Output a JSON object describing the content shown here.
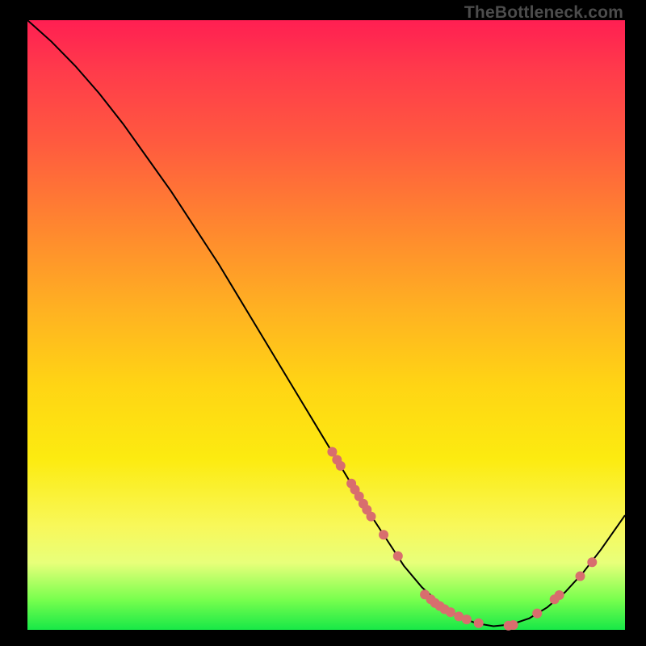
{
  "watermark": "TheBottleneck.com",
  "chart_data": {
    "type": "line",
    "title": "",
    "xlabel": "",
    "ylabel": "",
    "xlim": [
      0,
      100
    ],
    "ylim": [
      0,
      100
    ],
    "curve": {
      "x": [
        0,
        4,
        8,
        12,
        16,
        20,
        24,
        28,
        32,
        36,
        40,
        44,
        48,
        52,
        56,
        60,
        63,
        66,
        69,
        72,
        75,
        78,
        81,
        84,
        87,
        90,
        93,
        96,
        100
      ],
      "y": [
        100,
        96.5,
        92.5,
        88,
        83,
        77.5,
        72,
        66,
        60,
        53.5,
        47,
        40.5,
        34,
        27.5,
        21,
        15,
        10.5,
        7,
        4.3,
        2.3,
        1.1,
        0.6,
        0.9,
        1.9,
        3.7,
        6.2,
        9.4,
        13.2,
        18.8
      ]
    },
    "markers_left_slope": {
      "x": [
        51.0,
        51.8,
        52.4,
        54.2,
        54.8,
        55.5,
        56.2,
        56.8,
        57.5,
        59.6,
        62.0
      ],
      "y": [
        29.2,
        27.9,
        26.9,
        24.0,
        23.0,
        21.9,
        20.7,
        19.7,
        18.6,
        15.6,
        12.1
      ]
    },
    "markers_basin": {
      "x": [
        66.5,
        67.5,
        68.2,
        69.0,
        69.8,
        70.8,
        72.2,
        73.5,
        75.5,
        80.5,
        81.3
      ],
      "y": [
        5.8,
        5.0,
        4.4,
        3.9,
        3.4,
        2.9,
        2.2,
        1.7,
        1.1,
        0.7,
        0.8
      ]
    },
    "markers_right_slope": {
      "x": [
        85.3,
        88.2,
        89.0,
        92.5,
        94.5
      ],
      "y": [
        2.7,
        5.0,
        5.7,
        8.8,
        11.1
      ]
    },
    "marker_color": "#d86e6e",
    "marker_radius_px": 6
  }
}
